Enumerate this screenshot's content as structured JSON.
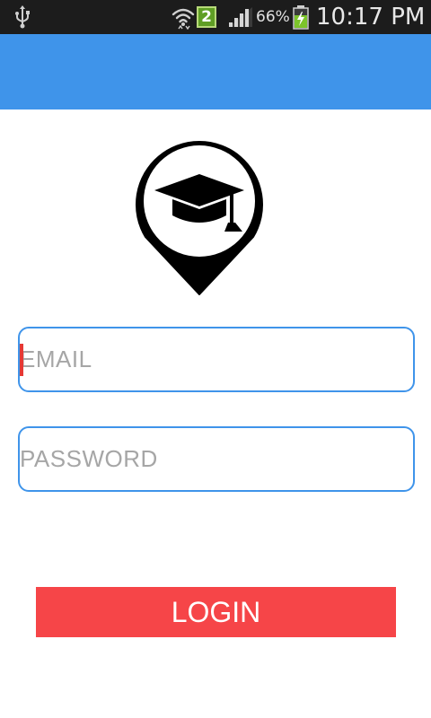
{
  "status_bar": {
    "notification_count": "2",
    "battery_percent": "66%",
    "time": "10:17 PM",
    "icons": [
      "usb-icon",
      "wifi-icon",
      "signal-icon",
      "battery-charging-icon"
    ]
  },
  "colors": {
    "action_bar": "#3f94ea",
    "field_border": "#3f94ea",
    "login_button": "#f64548",
    "caret": "#e53935"
  },
  "logo": {
    "icon": "location-pin-graduation-cap-icon"
  },
  "form": {
    "email_placeholder": "EMAIL",
    "password_placeholder": "PASSWORD",
    "login_label": "LOGIN"
  }
}
